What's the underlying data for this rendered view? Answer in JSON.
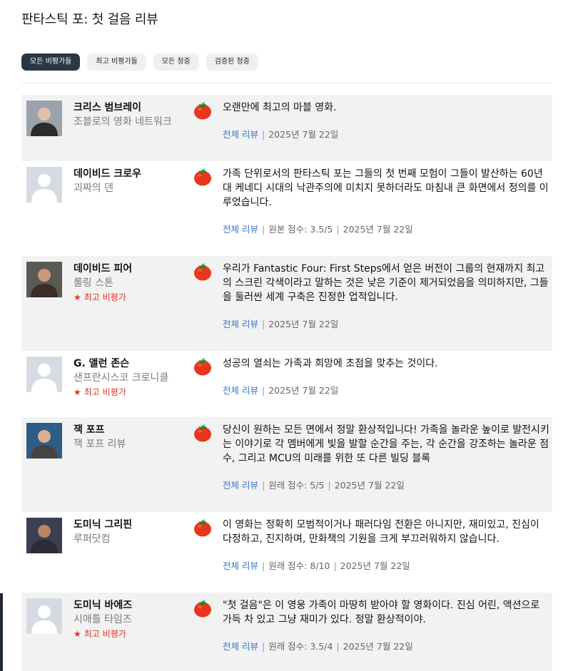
{
  "page": {
    "title": "판타스틱 포: 첫 걸음 리뷰"
  },
  "filters": [
    {
      "label": "모든 비평가들"
    },
    {
      "label": "최고 비평가들"
    },
    {
      "label": "모든 청중"
    },
    {
      "label": "검증된 청중"
    }
  ],
  "colors": {
    "active_filter": "#2a3845",
    "top_critic": "#e03524",
    "link": "#3a76c9",
    "shaded_row": "#f2f2f2",
    "tomato": "#e8361e"
  },
  "reviews": [
    {
      "critic": "크리스 범브레이",
      "publication": "조블로의 영화 네트워크",
      "top_critic": "",
      "quote": "오랜만에 최고의 마블 영화.",
      "full_review": "전체 리뷰",
      "score": "",
      "date": "2025년 7월 22일",
      "avatar_icon": "photo-icon",
      "rating_icon": "fresh-tomato-icon"
    },
    {
      "critic": "데이비드 크로우",
      "publication": "괴짜의 덴",
      "top_critic": "",
      "quote": "가족 단위로서의 판타스틱 포는 그들의 첫 번째 모험이 그들이 발산하는 60년대 케네디 시대의 낙관주의에 미치지 못하더라도 마침내 큰 화면에서 정의를 이루었습니다.",
      "full_review": "전체 리뷰",
      "score": "원본 점수: 3.5/5",
      "date": "2025년 7월 22일",
      "avatar_icon": "default-avatar-icon",
      "rating_icon": "fresh-tomato-icon"
    },
    {
      "critic": "데이비드 피어",
      "publication": "롤링 스톤",
      "top_critic": "최고 비평가",
      "quote": "우리가 Fantastic Four: First Steps에서 얻은 버전이 그룹의 현재까지 최고의 스크린 각색이라고 말하는 것은 낮은 기준이 제거되었음을 의미하지만, 그들을 둘러싼 세계 구축은 진정한 업적입니다.",
      "full_review": "전체 리뷰",
      "score": "",
      "date": "2025년 7월 22일",
      "avatar_icon": "photo-icon",
      "rating_icon": "fresh-tomato-icon"
    },
    {
      "critic": "G. 앨런 존슨",
      "publication": "샌프란시스코 크로니클",
      "top_critic": "최고 비평가",
      "quote": "성공의 열쇠는 가족과 희망에 초점을 맞추는 것이다.",
      "full_review": "전체 리뷰",
      "score": "",
      "date": "2025년 7월 22일",
      "avatar_icon": "default-avatar-icon",
      "rating_icon": "fresh-tomato-icon"
    },
    {
      "critic": "잭 포프",
      "publication": "잭 포프 리뷰",
      "top_critic": "",
      "quote": "당신이 원하는 모든 면에서 정말 환상적입니다! 가족을 놀라운 높이로 발전시키는 이야기로 각 멤버에게 빛을 발할 순간을 주는, 각 순간을 강조하는 놀라운 점수, 그리고 MCU의 미래를 위한 또 다른 빌딩 블록",
      "full_review": "전체 리뷰",
      "score": "원래 점수: 5/5",
      "date": "2025년 7월 22일",
      "avatar_icon": "photo-icon",
      "rating_icon": "fresh-tomato-icon"
    },
    {
      "critic": "도미닉 그리핀",
      "publication": "루퍼닷컴",
      "top_critic": "",
      "quote": "이 영화는 정확히 모범적이거나 패러다임 전환은 아니지만, 재미있고, 진심이 다정하고, 진지하며, 만화책의 기원을 크게 부끄러워하지 않습니다.",
      "full_review": "전체 리뷰",
      "score": "원래 점수: 8/10",
      "date": "2025년 7월 22일",
      "avatar_icon": "photo-icon",
      "rating_icon": "fresh-tomato-icon"
    },
    {
      "critic": "도미닉 바에즈",
      "publication": "시애틀 타임즈",
      "top_critic": "최고 비평가",
      "quote": "\"첫 걸음\"은 이 영웅 가족이 마땅히 받아야 할 영화이다. 진심 어린, 액션으로 가득 차 있고 그냥 재미가 있다. 정말 환상적이야.",
      "full_review": "전체 리뷰",
      "score": "원래 점수: 3.5/4",
      "date": "2025년 7월 22일",
      "avatar_icon": "default-avatar-icon",
      "rating_icon": "fresh-tomato-icon"
    }
  ]
}
